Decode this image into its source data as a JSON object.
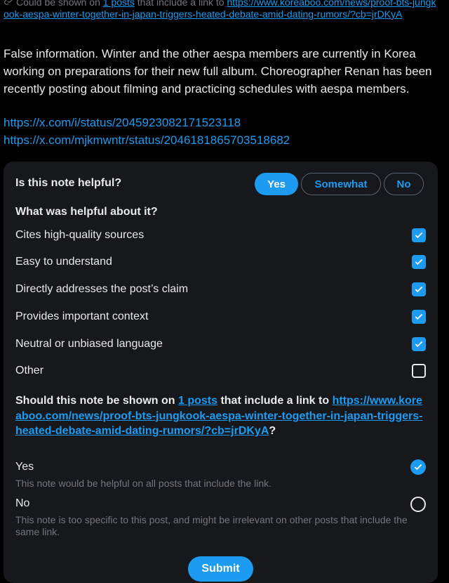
{
  "top_note": {
    "prefix": "Could be shown on ",
    "posts_link": "1 posts",
    "middle": " that include a link to ",
    "url": "https://www.koreaboo.com/news/proof-bts-jungkook-aespa-winter-together-in-japan-triggers-heated-debate-amid-dating-rumors/?cb=jrDKyA"
  },
  "note_body": "False information. Winter and the other aespa members are currently in Korea working on preparations for their new full album. Choreographer Renan has been recently posting about filming and practicing schedules with aespa members.",
  "note_links": [
    "https://x.com/i/status/2045923082171523118",
    "https://x.com/mjkmwntr/status/2046181865703518682"
  ],
  "rating": {
    "question": "Is this note helpful?",
    "options": [
      "Yes",
      "Somewhat",
      "No"
    ],
    "selected": "Yes"
  },
  "helpful": {
    "heading": "What was helpful about it?",
    "reasons": [
      {
        "label": "Cites high-quality sources",
        "checked": true
      },
      {
        "label": "Easy to understand",
        "checked": true
      },
      {
        "label": "Directly addresses the post’s claim",
        "checked": true
      },
      {
        "label": "Provides important context",
        "checked": true
      },
      {
        "label": "Neutral or unbiased language",
        "checked": true
      },
      {
        "label": "Other",
        "checked": false
      }
    ]
  },
  "shown": {
    "prefix": "Should this note be shown on ",
    "posts_link": "1 posts",
    "middle": " that include a link to ",
    "url": "https://www.koreaboo.com/news/proof-bts-jungkook-aespa-winter-together-in-japan-triggers-heated-debate-amid-dating-rumors/?cb=jrDKyA",
    "suffix": "?",
    "options": [
      {
        "label": "Yes",
        "description": "This note would be helpful on all posts that include the link.",
        "selected": true
      },
      {
        "label": "No",
        "description": "This note is too specific to this post, and might be irrelevant on other posts that include the same link.",
        "selected": false
      }
    ]
  },
  "submit_label": "Submit",
  "colors": {
    "accent": "#1d9bf0",
    "background": "#000000",
    "card": "#16181c"
  }
}
